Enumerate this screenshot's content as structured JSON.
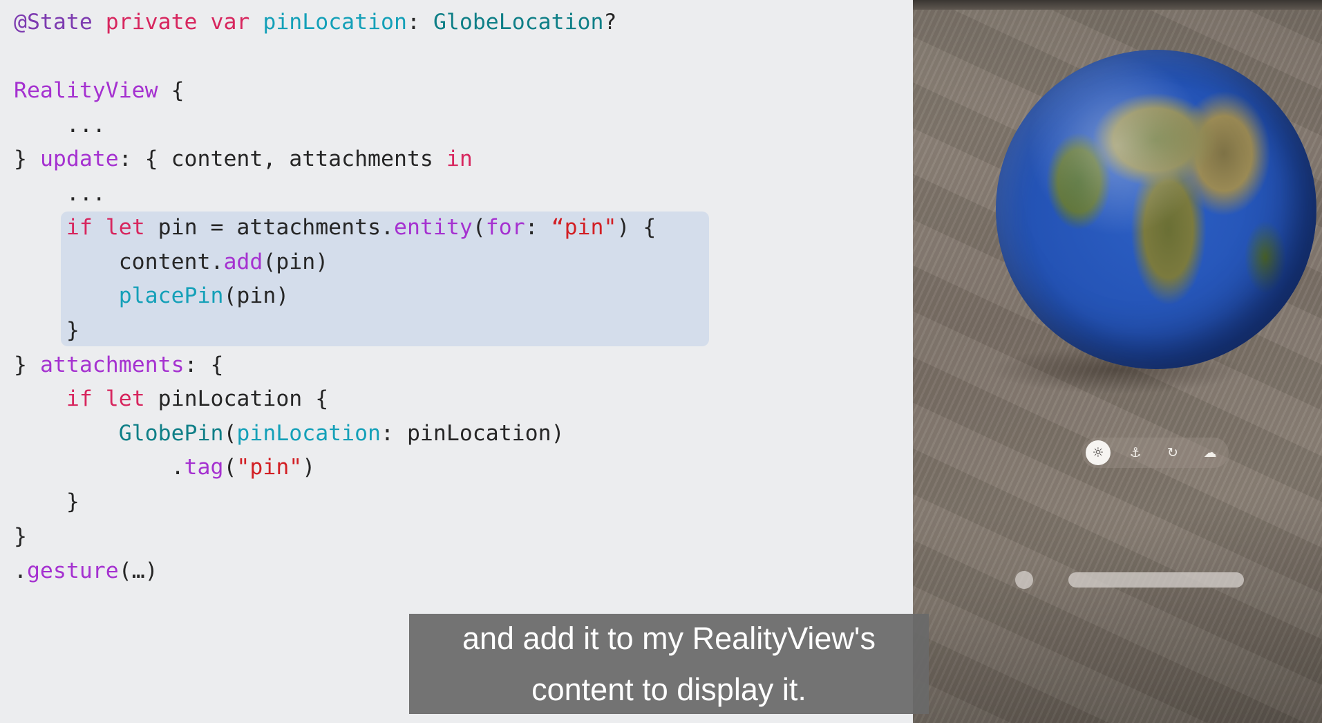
{
  "code": {
    "line1": {
      "t1": "@State",
      "t2": " ",
      "t3": "private",
      "t4": " ",
      "t5": "var",
      "t6": " ",
      "t7": "pinLocation",
      "t8": ": ",
      "t9": "GlobeLocation",
      "t10": "?"
    },
    "line2": {
      "t1": "RealityView",
      "t2": " {"
    },
    "line3": {
      "t1": "    ..."
    },
    "line4": {
      "t1": "} ",
      "t2": "update",
      "t3": ": { content, attachments ",
      "t4": "in"
    },
    "line5": {
      "t1": "    ..."
    },
    "line6": {
      "t1": "    ",
      "t2": "if",
      "t3": " ",
      "t4": "let",
      "t5": " pin = attachments.",
      "t6": "entity",
      "t7": "(",
      "t8": "for",
      "t9": ": ",
      "t10": "“pin\"",
      "t11": ") {"
    },
    "line7": {
      "t1": "        content.",
      "t2": "add",
      "t3": "(pin)"
    },
    "line8": {
      "t1": "        ",
      "t2": "placePin",
      "t3": "(pin)"
    },
    "line9": {
      "t1": "    }"
    },
    "line10": {
      "t1": "} ",
      "t2": "attachments",
      "t3": ": {"
    },
    "line11": {
      "t1": "    ",
      "t2": "if",
      "t3": " ",
      "t4": "let",
      "t5": " pinLocation {"
    },
    "line12": {
      "t1": "        ",
      "t2": "GlobePin",
      "t3": "(",
      "t4": "pinLocation",
      "t5": ": pinLocation)"
    },
    "line13": {
      "t1": "            .",
      "t2": "tag",
      "t3": "(",
      "t4": "\"pin\"",
      "t5": ")"
    },
    "line14": {
      "t1": "    }"
    },
    "line15": {
      "t1": "}"
    },
    "line16": {
      "t1": ".",
      "t2": "gesture",
      "t3": "(…)"
    }
  },
  "ornament": {
    "buttons": [
      {
        "icon": "sun-icon",
        "glyph": "☼"
      },
      {
        "icon": "pin-icon",
        "glyph": "⚓"
      },
      {
        "icon": "rotate-icon",
        "glyph": "↻"
      },
      {
        "icon": "cloud-sun-icon",
        "glyph": "☁"
      }
    ]
  },
  "caption": {
    "line1": "and add it to my RealityView's",
    "line2": "content to display it."
  },
  "colors": {
    "keyword": "#d7265e",
    "attribute": "#7d3bb0",
    "function": "#a531d0",
    "type": "#0f7f87",
    "property": "#14a0b8",
    "string": "#d21f24",
    "highlight": "#d4ddeb"
  }
}
